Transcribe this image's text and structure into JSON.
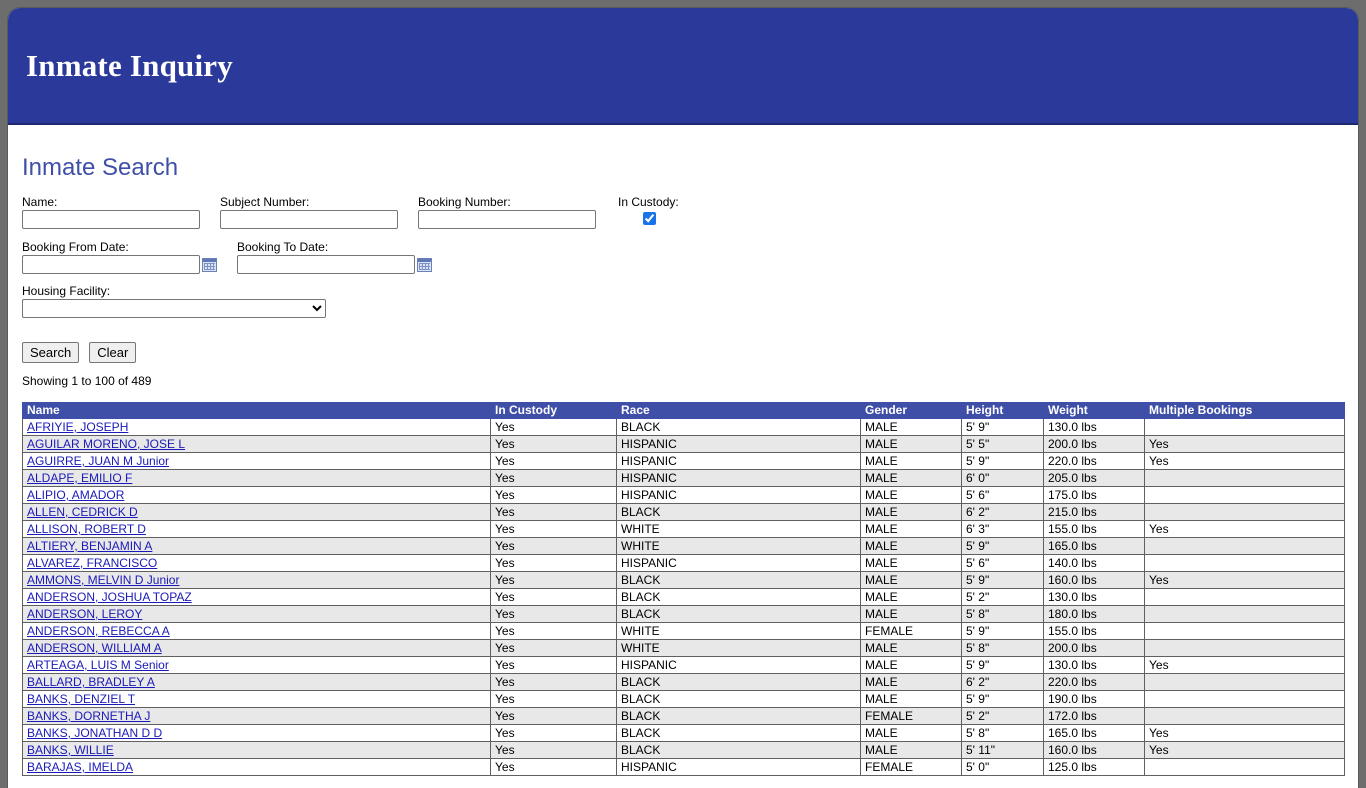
{
  "banner": {
    "title": "Inmate Inquiry"
  },
  "search": {
    "heading": "Inmate Search",
    "name_label": "Name:",
    "subject_label": "Subject Number:",
    "booking_label": "Booking Number:",
    "custody_label": "In Custody:",
    "custody_checked": true,
    "from_label": "Booking From Date:",
    "to_label": "Booking To Date:",
    "housing_label": "Housing Facility:",
    "housing_selected": "",
    "search_button": "Search",
    "clear_button": "Clear"
  },
  "results": {
    "summary": "Showing 1 to 100 of 489",
    "columns": [
      "Name",
      "In Custody",
      "Race",
      "Gender",
      "Height",
      "Weight",
      "Multiple Bookings"
    ],
    "rows": [
      [
        "AFRIYIE, JOSEPH",
        "Yes",
        "BLACK",
        "MALE",
        "5' 9\"",
        "130.0 lbs",
        ""
      ],
      [
        "AGUILAR MORENO, JOSE L",
        "Yes",
        "HISPANIC",
        "MALE",
        "5' 5\"",
        "200.0 lbs",
        "Yes"
      ],
      [
        "AGUIRRE, JUAN M Junior",
        "Yes",
        "HISPANIC",
        "MALE",
        "5' 9\"",
        "220.0 lbs",
        "Yes"
      ],
      [
        "ALDAPE, EMILIO F",
        "Yes",
        "HISPANIC",
        "MALE",
        "6' 0\"",
        "205.0 lbs",
        ""
      ],
      [
        "ALIPIO, AMADOR",
        "Yes",
        "HISPANIC",
        "MALE",
        "5' 6\"",
        "175.0 lbs",
        ""
      ],
      [
        "ALLEN, CEDRICK D",
        "Yes",
        "BLACK",
        "MALE",
        "6' 2\"",
        "215.0 lbs",
        ""
      ],
      [
        "ALLISON, ROBERT D",
        "Yes",
        "WHITE",
        "MALE",
        "6' 3\"",
        "155.0 lbs",
        "Yes"
      ],
      [
        "ALTIERY, BENJAMIN A",
        "Yes",
        "WHITE",
        "MALE",
        "5' 9\"",
        "165.0 lbs",
        ""
      ],
      [
        "ALVAREZ, FRANCISCO",
        "Yes",
        "HISPANIC",
        "MALE",
        "5' 6\"",
        "140.0 lbs",
        ""
      ],
      [
        "AMMONS, MELVIN D Junior",
        "Yes",
        "BLACK",
        "MALE",
        "5' 9\"",
        "160.0 lbs",
        "Yes"
      ],
      [
        "ANDERSON, JOSHUA TOPAZ",
        "Yes",
        "BLACK",
        "MALE",
        "5' 2\"",
        "130.0 lbs",
        ""
      ],
      [
        "ANDERSON, LEROY",
        "Yes",
        "BLACK",
        "MALE",
        "5' 8\"",
        "180.0 lbs",
        ""
      ],
      [
        "ANDERSON, REBECCA A",
        "Yes",
        "WHITE",
        "FEMALE",
        "5' 9\"",
        "155.0 lbs",
        ""
      ],
      [
        "ANDERSON, WILLIAM A",
        "Yes",
        "WHITE",
        "MALE",
        "5' 8\"",
        "200.0 lbs",
        ""
      ],
      [
        "ARTEAGA, LUIS M Senior",
        "Yes",
        "HISPANIC",
        "MALE",
        "5' 9\"",
        "130.0 lbs",
        "Yes"
      ],
      [
        "BALLARD, BRADLEY A",
        "Yes",
        "BLACK",
        "MALE",
        "6' 2\"",
        "220.0 lbs",
        ""
      ],
      [
        "BANKS, DENZIEL T",
        "Yes",
        "BLACK",
        "MALE",
        "5' 9\"",
        "190.0 lbs",
        ""
      ],
      [
        "BANKS, DORNETHA J",
        "Yes",
        "BLACK",
        "FEMALE",
        "5' 2\"",
        "172.0 lbs",
        ""
      ],
      [
        "BANKS, JONATHAN D D",
        "Yes",
        "BLACK",
        "MALE",
        "5' 8\"",
        "165.0 lbs",
        "Yes"
      ],
      [
        "BANKS, WILLIE",
        "Yes",
        "BLACK",
        "MALE",
        "5' 11\"",
        "160.0 lbs",
        "Yes"
      ],
      [
        "BARAJAS, IMELDA",
        "Yes",
        "HISPANIC",
        "FEMALE",
        "5' 0\"",
        "125.0 lbs",
        ""
      ]
    ]
  }
}
